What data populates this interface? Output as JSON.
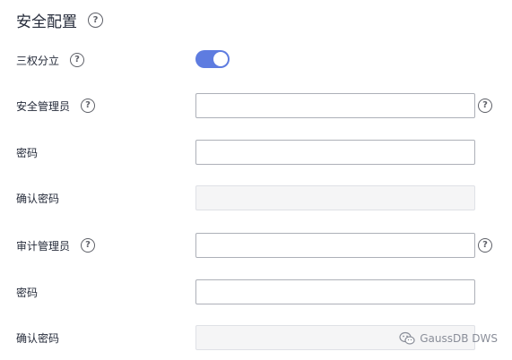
{
  "section": {
    "title": "安全配置"
  },
  "separation": {
    "label": "三权分立",
    "enabled": true
  },
  "security_admin": {
    "label": "安全管理员",
    "username_value": "",
    "password_label": "密码",
    "password_value": "",
    "confirm_label": "确认密码",
    "confirm_value": ""
  },
  "audit_admin": {
    "label": "审计管理员",
    "username_value": "",
    "password_label": "密码",
    "password_value": "",
    "confirm_label": "确认密码",
    "confirm_value": ""
  },
  "icons": {
    "help": "help-circle-icon",
    "watermark": "wechat-logo-icon"
  },
  "colors": {
    "accent": "#5e7ce0",
    "text": "#252b3a",
    "border": "#adb0b8",
    "disabled_bg": "#f5f5f6"
  },
  "watermark": {
    "text": "GaussDB DWS"
  }
}
